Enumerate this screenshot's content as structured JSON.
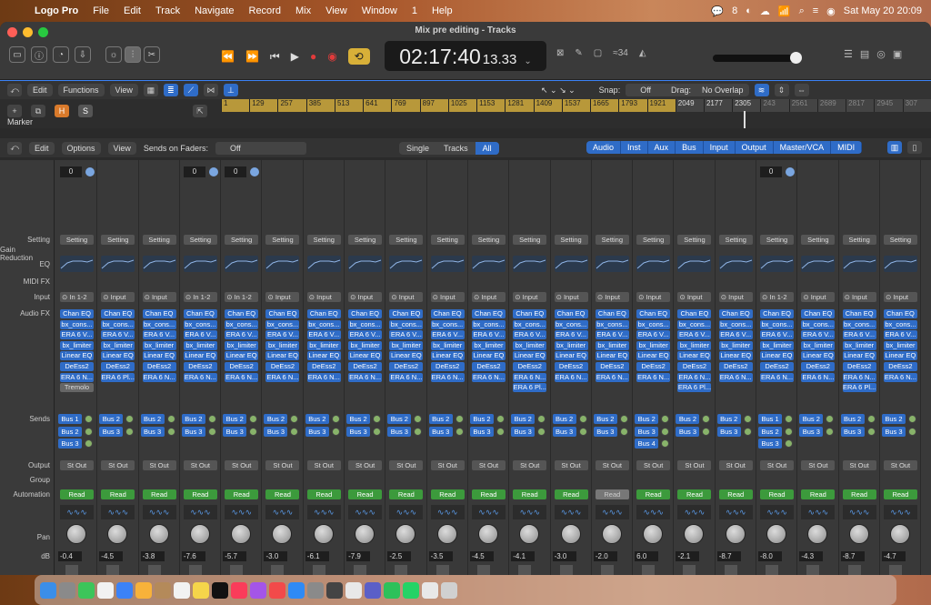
{
  "menubar": {
    "apple": "",
    "items": [
      "Logo Pro",
      "File",
      "Edit",
      "Track",
      "Navigate",
      "Record",
      "Mix",
      "View",
      "Window",
      "1",
      "Help"
    ],
    "wechat_count": "8",
    "datetime": "Sat May 20  20:09"
  },
  "window": {
    "title": "Mix pre editing - Tracks",
    "lcd_main": "02:17:40",
    "lcd_sub": "13.33",
    "tuner": "≈34"
  },
  "tracks_bar": {
    "edit": "Edit",
    "functions": "Functions",
    "view": "View",
    "snap_label": "Snap:",
    "snap_value": "Off",
    "drag_label": "Drag:",
    "drag_value": "No Overlap"
  },
  "ruler": {
    "bars": [
      "1",
      "129",
      "257",
      "385",
      "513",
      "641",
      "769",
      "897",
      "1025",
      "1153",
      "1281",
      "1409",
      "1537",
      "1665",
      "1793",
      "1921",
      "2049",
      "2177",
      "2305",
      "243",
      "2561",
      "2689",
      "2817",
      "2945",
      "307"
    ],
    "marker": "Marker",
    "h_label": "H",
    "s_label": "S"
  },
  "mixer_bar": {
    "edit": "Edit",
    "options": "Options",
    "view": "View",
    "sends_label": "Sends on Faders:",
    "sends_value": "Off",
    "view_modes": [
      "Single",
      "Tracks",
      "All"
    ],
    "types": [
      "Audio",
      "Inst",
      "Aux",
      "Bus",
      "Input",
      "Output",
      "Master/VCA",
      "MIDI"
    ]
  },
  "row_labels": {
    "setting": "Setting",
    "gain": "Gain Reduction",
    "eq": "EQ",
    "midi_fx": "MIDI FX",
    "input": "Input",
    "audio_fx": "Audio FX",
    "sends": "Sends",
    "output": "Output",
    "group": "Group",
    "automation": "Automation",
    "pan": "Pan",
    "db": "dB"
  },
  "strip_common": {
    "setting": "Setting",
    "output": "St Out",
    "automation": "Read"
  },
  "strips": [
    {
      "num": "0",
      "input": "In 1-2",
      "fx": [
        "Chan EQ",
        "bx_cons...",
        "ERA 6 V...",
        "bx_limiter",
        "Linear EQ",
        "DeEss2",
        "ERA 6 N...",
        "Tremolo"
      ],
      "sends": [
        "Bus 1",
        "Bus 2",
        "Bus 3"
      ],
      "db": "-0.4"
    },
    {
      "num": "",
      "input": "Input",
      "fx": [
        "Chan EQ",
        "bx_cons...",
        "ERA 6 V...",
        "bx_limiter",
        "Linear EQ",
        "DeEss2",
        "ERA 6 Pl..."
      ],
      "sends": [
        "Bus 2",
        "Bus 3"
      ],
      "db": "-4.5"
    },
    {
      "num": "",
      "input": "Input",
      "fx": [
        "Chan EQ",
        "bx_cons...",
        "ERA 6 V...",
        "bx_limiter",
        "Linear EQ",
        "DeEss2",
        "ERA 6 N..."
      ],
      "sends": [
        "Bus 2",
        "Bus 3"
      ],
      "db": "-3.8"
    },
    {
      "num": "0",
      "input": "In 1-2",
      "fx": [
        "Chan EQ",
        "bx_cons...",
        "ERA 6 V...",
        "bx_limiter",
        "Linear EQ",
        "DeEss2",
        "ERA 6 N..."
      ],
      "sends": [
        "Bus 2",
        "Bus 3"
      ],
      "db": "-7.6"
    },
    {
      "num": "0",
      "input": "In 1-2",
      "fx": [
        "Chan EQ",
        "bx_cons...",
        "ERA 6 V...",
        "bx_limiter",
        "Linear EQ",
        "DeEss2",
        "ERA 6 N..."
      ],
      "sends": [
        "Bus 2",
        "Bus 3"
      ],
      "db": "-5.7"
    },
    {
      "num": "",
      "input": "Input",
      "fx": [
        "Chan EQ",
        "bx_cons...",
        "ERA 6 V...",
        "bx_limiter",
        "Linear EQ",
        "DeEss2",
        "ERA 6 N..."
      ],
      "sends": [
        "Bus 2",
        "Bus 3"
      ],
      "db": "-3.0"
    },
    {
      "num": "",
      "input": "Input",
      "fx": [
        "Chan EQ",
        "bx_cons...",
        "ERA 6 V...",
        "bx_limiter",
        "Linear EQ",
        "DeEss2",
        "ERA 6 N..."
      ],
      "sends": [
        "Bus 2",
        "Bus 3"
      ],
      "db": "-6.1"
    },
    {
      "num": "",
      "input": "Input",
      "fx": [
        "Chan EQ",
        "bx_cons...",
        "ERA 6 V...",
        "bx_limiter",
        "Linear EQ",
        "DeEss2",
        "ERA 6 N..."
      ],
      "sends": [
        "Bus 2",
        "Bus 3"
      ],
      "db": "-7.9"
    },
    {
      "num": "",
      "input": "Input",
      "fx": [
        "Chan EQ",
        "bx_cons...",
        "ERA 6 V...",
        "bx_limiter",
        "Linear EQ",
        "DeEss2",
        "ERA 6 N..."
      ],
      "sends": [
        "Bus 2",
        "Bus 3"
      ],
      "db": "-2.5"
    },
    {
      "num": "",
      "input": "Input",
      "fx": [
        "Chan EQ",
        "bx_cons...",
        "ERA 6 V...",
        "bx_limiter",
        "Linear EQ",
        "DeEss2",
        "ERA 6 N..."
      ],
      "sends": [
        "Bus 2",
        "Bus 3"
      ],
      "db": "-3.5"
    },
    {
      "num": "",
      "input": "Input",
      "fx": [
        "Chan EQ",
        "bx_cons...",
        "ERA 6 V...",
        "bx_limiter",
        "Linear EQ",
        "DeEss2",
        "ERA 6 N..."
      ],
      "sends": [
        "Bus 2",
        "Bus 3"
      ],
      "db": "-4.5"
    },
    {
      "num": "",
      "input": "Input",
      "fx": [
        "Chan EQ",
        "bx_cons...",
        "ERA 6 V...",
        "bx_limiter",
        "Linear EQ",
        "DeEss2",
        "ERA 6 N...",
        "ERA 6 Pl..."
      ],
      "sends": [
        "Bus 2",
        "Bus 3"
      ],
      "db": "-4.1"
    },
    {
      "num": "",
      "input": "Input",
      "fx": [
        "Chan EQ",
        "bx_cons...",
        "ERA 6 V...",
        "bx_limiter",
        "Linear EQ",
        "DeEss2",
        "ERA 6 N..."
      ],
      "sends": [
        "Bus 2",
        "Bus 3"
      ],
      "db": "-3.0"
    },
    {
      "num": "",
      "input": "Input",
      "fx": [
        "Chan EQ",
        "bx_cons...",
        "ERA 6 V...",
        "bx_limiter",
        "Linear EQ",
        "DeEss2",
        "ERA 6 N..."
      ],
      "sends": [
        "Bus 2",
        "Bus 3"
      ],
      "db": "-2.0",
      "auto_off": true
    },
    {
      "num": "",
      "input": "Input",
      "fx": [
        "Chan EQ",
        "bx_cons...",
        "ERA 6 V...",
        "bx_limiter",
        "Linear EQ",
        "DeEss2",
        "ERA 6 N..."
      ],
      "sends": [
        "Bus 2",
        "Bus 3",
        "Bus 4"
      ],
      "db": "6.0"
    },
    {
      "num": "",
      "input": "Input",
      "fx": [
        "Chan EQ",
        "bx_cons...",
        "ERA 6 V...",
        "bx_limiter",
        "Linear EQ",
        "DeEss2",
        "ERA 6 N...",
        "ERA 6 Pl..."
      ],
      "sends": [
        "Bus 2",
        "Bus 3"
      ],
      "db": "-2.1"
    },
    {
      "num": "",
      "input": "Input",
      "fx": [
        "Chan EQ",
        "bx_cons...",
        "ERA 6 V...",
        "bx_limiter",
        "Linear EQ",
        "DeEss2",
        "ERA 6 N..."
      ],
      "sends": [
        "Bus 2",
        "Bus 3"
      ],
      "db": "-8.7"
    },
    {
      "num": "0",
      "input": "In 1-2",
      "fx": [
        "Chan EQ",
        "bx_cons...",
        "ERA 6 V...",
        "bx_limiter",
        "Linear EQ",
        "DeEss2",
        "ERA 6 N..."
      ],
      "sends": [
        "Bus 1",
        "Bus 2",
        "Bus 3"
      ],
      "db": "-8.0"
    },
    {
      "num": "",
      "input": "Input",
      "fx": [
        "Chan EQ",
        "bx_cons...",
        "ERA 6 V...",
        "bx_limiter",
        "Linear EQ",
        "DeEss2",
        "ERA 6 N..."
      ],
      "sends": [
        "Bus 2",
        "Bus 3"
      ],
      "db": "-4.3"
    },
    {
      "num": "",
      "input": "Input",
      "fx": [
        "Chan EQ",
        "bx_cons...",
        "ERA 6 V...",
        "bx_limiter",
        "Linear EQ",
        "DeEss2",
        "ERA 6 N...",
        "ERA 6 Pl..."
      ],
      "sends": [
        "Bus 2",
        "Bus 3"
      ],
      "db": "-8.7"
    },
    {
      "num": "",
      "input": "Input",
      "fx": [
        "Chan EQ",
        "bx_cons...",
        "ERA 6 V...",
        "bx_limiter",
        "Linear EQ",
        "DeEss2",
        "ERA 6 N..."
      ],
      "sends": [
        "Bus 2",
        "Bus 3"
      ],
      "db": "-4.7"
    }
  ],
  "colors": {
    "accent_blue": "#2f6cc7",
    "read_green": "#3c9a3c",
    "cycle_yellow": "#d8b038",
    "record_red": "#e23b3b"
  },
  "dock_icons": [
    "finder",
    "launchpad",
    "messages",
    "calendar",
    "mail",
    "photos",
    "contacts",
    "reminders",
    "notes",
    "appletv",
    "music",
    "podcasts",
    "news",
    "appstore",
    "settings",
    "logic",
    "chrome",
    "teams",
    "wechat",
    "whatsapp",
    "preview",
    "trash"
  ]
}
